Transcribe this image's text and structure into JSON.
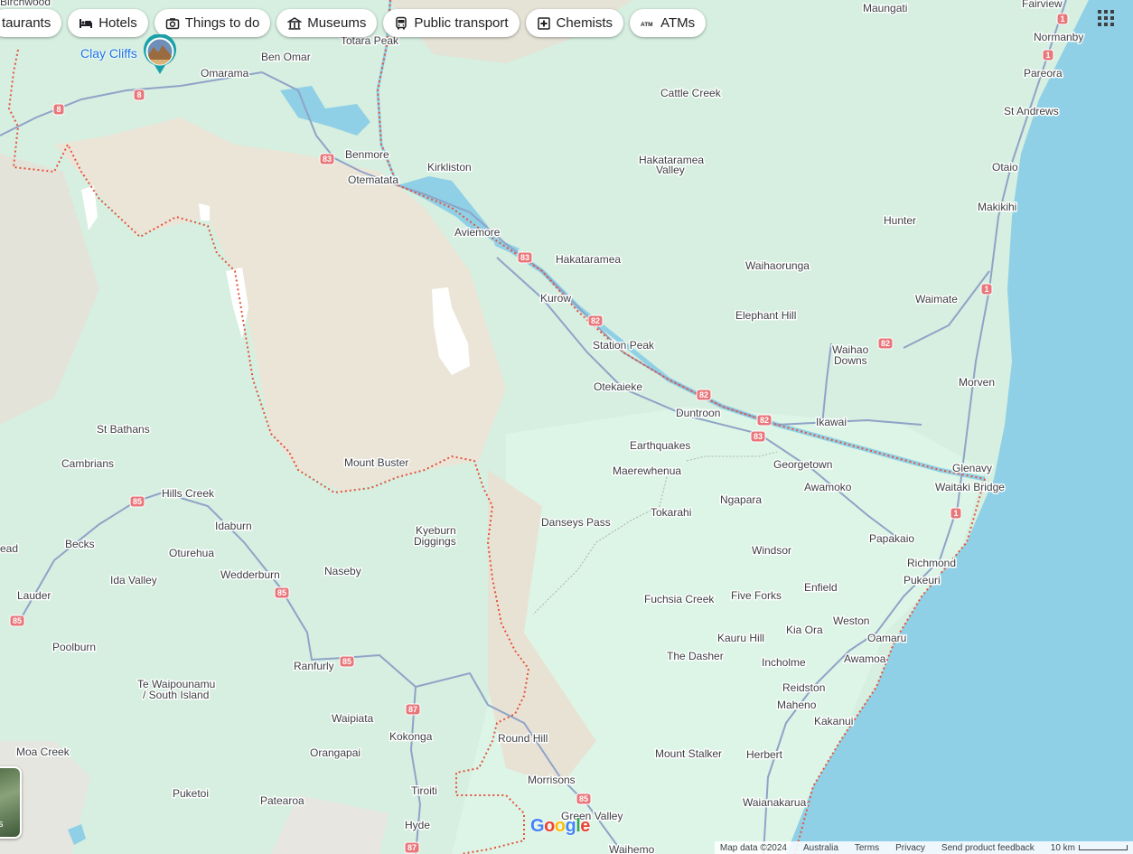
{
  "chips": [
    {
      "label": "taurants",
      "icon": "restaurant-icon"
    },
    {
      "label": "Hotels",
      "icon": "hotel-bed-icon"
    },
    {
      "label": "Things to do",
      "icon": "camera-icon"
    },
    {
      "label": "Museums",
      "icon": "museum-icon"
    },
    {
      "label": "Public transport",
      "icon": "bus-icon"
    },
    {
      "label": "Chemists",
      "icon": "pharmacy-icon"
    },
    {
      "label": "ATMs",
      "icon": "atm-icon"
    }
  ],
  "poi": {
    "label": "Clay Cliffs",
    "icon": "photo-pin-icon"
  },
  "layers_thumb_label": "s",
  "places": [
    "Birchwood",
    "Maungati",
    "Fairview",
    "Normanby",
    "Pareora",
    "Totara Peak",
    "Ben Omar",
    "Omarama",
    "Cattle Creek",
    "St Andrews",
    "Otaio",
    "Benmore",
    "Kirkliston",
    "Hakataramea",
    "Valley",
    "Otematata",
    "Makikihi",
    "Hunter",
    "Aviemore",
    "Hakataramea",
    "Waihaorunga",
    "Kurow",
    "Waimate",
    "Elephant Hill",
    "Station Peak",
    "Waihao",
    "Downs",
    "Otekaieke",
    "Morven",
    "Duntroon",
    "Ikawai",
    "St Bathans",
    "Earthquakes",
    "Cambrians",
    "Mount Buster",
    "Maerewhenua",
    "Georgetown",
    "Glenavy",
    "Awamoko",
    "Waitaki Bridge",
    "Hills Creek",
    "Ngapara",
    "Tokarahi",
    "Danseys Pass",
    "Idaburn",
    "Kyeburn",
    "Diggings",
    "Papakaio",
    "ead",
    "Becks",
    "Oturehua",
    "Windsor",
    "Richmond",
    "Naseby",
    "Wedderburn",
    "Ida Valley",
    "Pukeuri",
    "Enfield",
    "Lauder",
    "Fuchsia Creek",
    "Five Forks",
    "Weston",
    "Kia Ora",
    "Oamaru",
    "Poolburn",
    "Kauru Hill",
    "Awamoa",
    "The Dasher",
    "Ranfurly",
    "Incholme",
    "Te Waipounamu",
    "/ South Island",
    "Reidston",
    "Maheno",
    "Waipiata",
    "Kakanui",
    "Kokonga",
    "Round Hill",
    "Moa Creek",
    "Orangapai",
    "Mount Stalker",
    "Herbert",
    "Morrisons",
    "Tiroiti",
    "Puketoi",
    "Patearoa",
    "Waianakarua",
    "Green Valley",
    "Hyde",
    "Waihemo"
  ],
  "shields": [
    "1",
    "1",
    "1",
    "1",
    "8",
    "8",
    "83",
    "83",
    "83",
    "82",
    "82",
    "82",
    "82",
    "85",
    "85",
    "85",
    "85",
    "87",
    "85",
    "87"
  ],
  "logo": {
    "g1": "G",
    "o1": "o",
    "o2": "o",
    "g2": "g",
    "l": "l",
    "e": "e"
  },
  "footer": {
    "map_data": "Map data ©2024",
    "region": "Australia",
    "terms": "Terms",
    "privacy": "Privacy",
    "feedback": "Send product feedback",
    "scale": "10 km"
  },
  "colors": {
    "water": "#8fd0e6",
    "land": "#d6efe0",
    "mountain": "#e9e2d5",
    "road": "#8fa3c7",
    "state_highway_shield": "#e8777b",
    "boundary": "#e5533c"
  }
}
